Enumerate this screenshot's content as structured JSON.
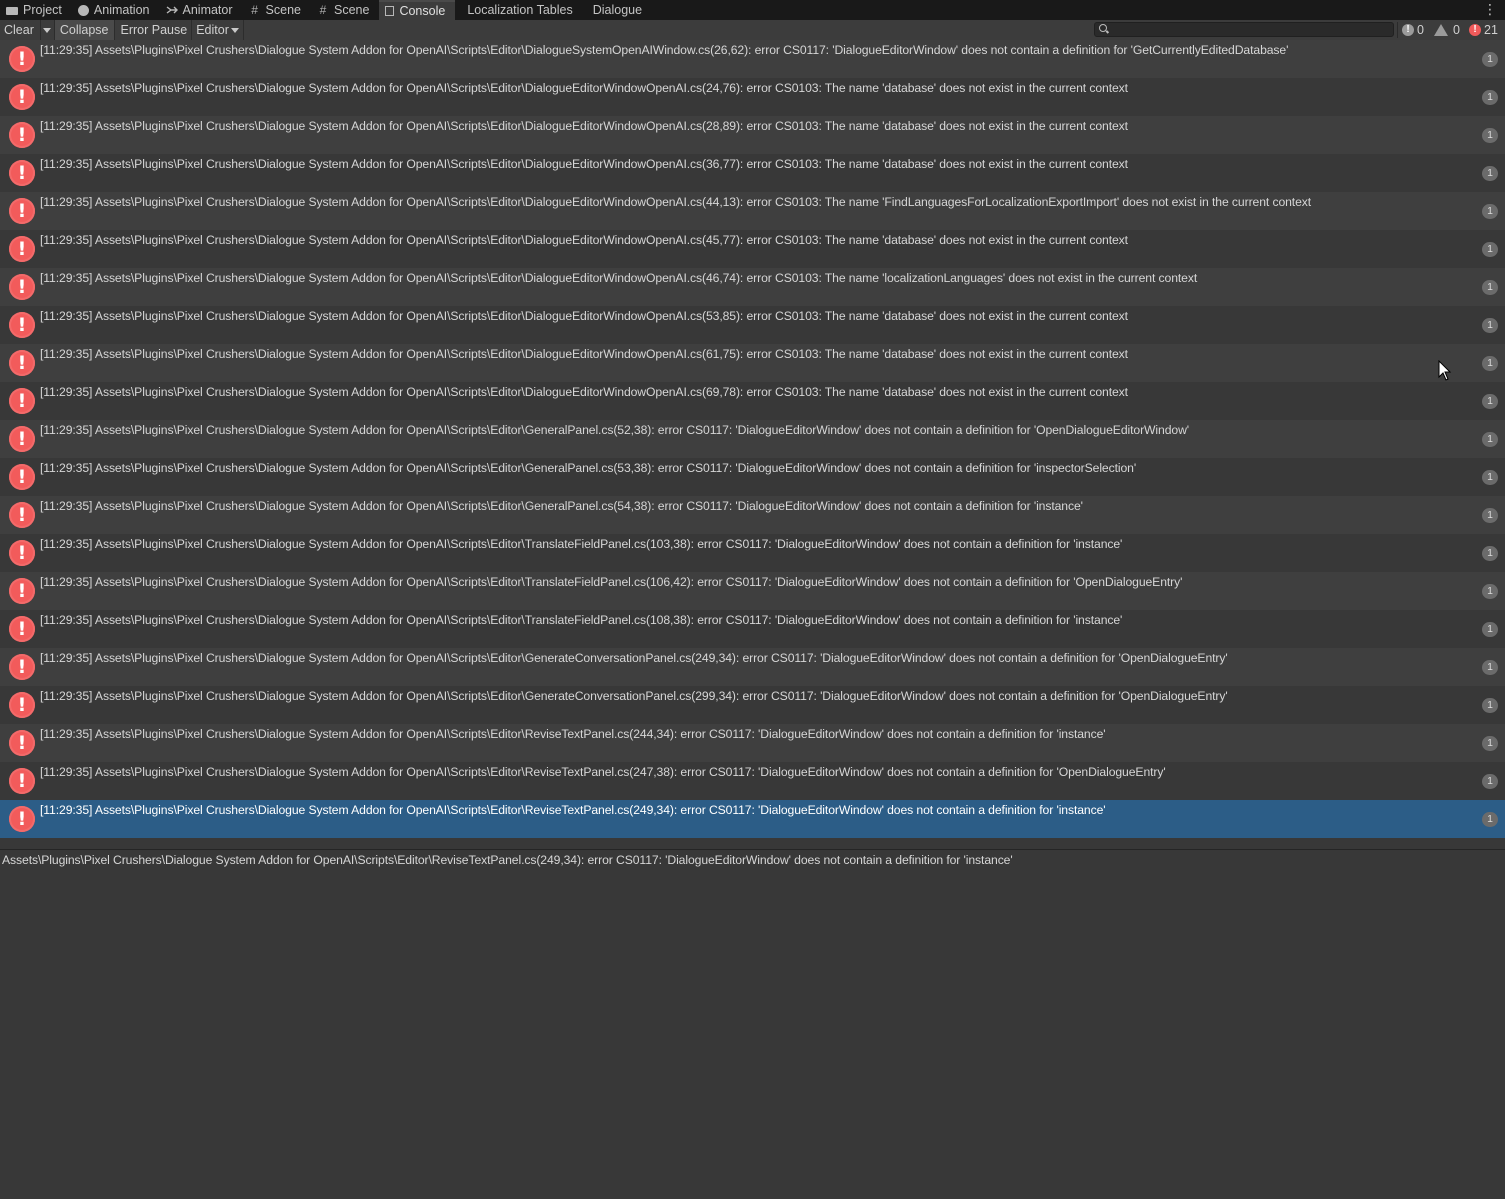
{
  "tabs": [
    {
      "label": "Project",
      "icon": "folder-icon"
    },
    {
      "label": "Animation",
      "icon": "animation-icon"
    },
    {
      "label": "Animator",
      "icon": "animator-icon"
    },
    {
      "label": "Scene",
      "icon": "scene-grid-icon"
    },
    {
      "label": "Scene",
      "icon": "scene-grid-icon"
    },
    {
      "label": "Console",
      "icon": "console-icon",
      "active": true
    },
    {
      "label": "Localization Tables"
    },
    {
      "label": "Dialogue"
    }
  ],
  "toolbar": {
    "clear": "Clear",
    "collapse": "Collapse",
    "error_pause": "Error Pause",
    "editor": "Editor",
    "search_placeholder": ""
  },
  "counts": {
    "info": "0",
    "warnings": "0",
    "errors": "21"
  },
  "colors": {
    "error": "#f25b5b",
    "selected": "#2c5d87",
    "panel": "#383838"
  },
  "log": [
    {
      "text": "[11:29:35] Assets\\Plugins\\Pixel Crushers\\Dialogue System Addon for OpenAI\\Scripts\\Editor\\DialogueSystemOpenAIWindow.cs(26,62): error CS0117: 'DialogueEditorWindow' does not contain a definition for 'GetCurrentlyEditedDatabase'",
      "count": "1"
    },
    {
      "text": "[11:29:35] Assets\\Plugins\\Pixel Crushers\\Dialogue System Addon for OpenAI\\Scripts\\Editor\\DialogueEditorWindowOpenAI.cs(24,76): error CS0103: The name 'database' does not exist in the current context",
      "count": "1"
    },
    {
      "text": "[11:29:35] Assets\\Plugins\\Pixel Crushers\\Dialogue System Addon for OpenAI\\Scripts\\Editor\\DialogueEditorWindowOpenAI.cs(28,89): error CS0103: The name 'database' does not exist in the current context",
      "count": "1"
    },
    {
      "text": "[11:29:35] Assets\\Plugins\\Pixel Crushers\\Dialogue System Addon for OpenAI\\Scripts\\Editor\\DialogueEditorWindowOpenAI.cs(36,77): error CS0103: The name 'database' does not exist in the current context",
      "count": "1"
    },
    {
      "text": "[11:29:35] Assets\\Plugins\\Pixel Crushers\\Dialogue System Addon for OpenAI\\Scripts\\Editor\\DialogueEditorWindowOpenAI.cs(44,13): error CS0103: The name 'FindLanguagesForLocalizationExportImport' does not exist in the current context",
      "count": "1"
    },
    {
      "text": "[11:29:35] Assets\\Plugins\\Pixel Crushers\\Dialogue System Addon for OpenAI\\Scripts\\Editor\\DialogueEditorWindowOpenAI.cs(45,77): error CS0103: The name 'database' does not exist in the current context",
      "count": "1"
    },
    {
      "text": "[11:29:35] Assets\\Plugins\\Pixel Crushers\\Dialogue System Addon for OpenAI\\Scripts\\Editor\\DialogueEditorWindowOpenAI.cs(46,74): error CS0103: The name 'localizationLanguages' does not exist in the current context",
      "count": "1"
    },
    {
      "text": "[11:29:35] Assets\\Plugins\\Pixel Crushers\\Dialogue System Addon for OpenAI\\Scripts\\Editor\\DialogueEditorWindowOpenAI.cs(53,85): error CS0103: The name 'database' does not exist in the current context",
      "count": "1"
    },
    {
      "text": "[11:29:35] Assets\\Plugins\\Pixel Crushers\\Dialogue System Addon for OpenAI\\Scripts\\Editor\\DialogueEditorWindowOpenAI.cs(61,75): error CS0103: The name 'database' does not exist in the current context",
      "count": "1"
    },
    {
      "text": "[11:29:35] Assets\\Plugins\\Pixel Crushers\\Dialogue System Addon for OpenAI\\Scripts\\Editor\\DialogueEditorWindowOpenAI.cs(69,78): error CS0103: The name 'database' does not exist in the current context",
      "count": "1"
    },
    {
      "text": "[11:29:35] Assets\\Plugins\\Pixel Crushers\\Dialogue System Addon for OpenAI\\Scripts\\Editor\\GeneralPanel.cs(52,38): error CS0117: 'DialogueEditorWindow' does not contain a definition for 'OpenDialogueEditorWindow'",
      "count": "1"
    },
    {
      "text": "[11:29:35] Assets\\Plugins\\Pixel Crushers\\Dialogue System Addon for OpenAI\\Scripts\\Editor\\GeneralPanel.cs(53,38): error CS0117: 'DialogueEditorWindow' does not contain a definition for 'inspectorSelection'",
      "count": "1"
    },
    {
      "text": "[11:29:35] Assets\\Plugins\\Pixel Crushers\\Dialogue System Addon for OpenAI\\Scripts\\Editor\\GeneralPanel.cs(54,38): error CS0117: 'DialogueEditorWindow' does not contain a definition for 'instance'",
      "count": "1"
    },
    {
      "text": "[11:29:35] Assets\\Plugins\\Pixel Crushers\\Dialogue System Addon for OpenAI\\Scripts\\Editor\\TranslateFieldPanel.cs(103,38): error CS0117: 'DialogueEditorWindow' does not contain a definition for 'instance'",
      "count": "1"
    },
    {
      "text": "[11:29:35] Assets\\Plugins\\Pixel Crushers\\Dialogue System Addon for OpenAI\\Scripts\\Editor\\TranslateFieldPanel.cs(106,42): error CS0117: 'DialogueEditorWindow' does not contain a definition for 'OpenDialogueEntry'",
      "count": "1"
    },
    {
      "text": "[11:29:35] Assets\\Plugins\\Pixel Crushers\\Dialogue System Addon for OpenAI\\Scripts\\Editor\\TranslateFieldPanel.cs(108,38): error CS0117: 'DialogueEditorWindow' does not contain a definition for 'instance'",
      "count": "1"
    },
    {
      "text": "[11:29:35] Assets\\Plugins\\Pixel Crushers\\Dialogue System Addon for OpenAI\\Scripts\\Editor\\GenerateConversationPanel.cs(249,34): error CS0117: 'DialogueEditorWindow' does not contain a definition for 'OpenDialogueEntry'",
      "count": "1"
    },
    {
      "text": "[11:29:35] Assets\\Plugins\\Pixel Crushers\\Dialogue System Addon for OpenAI\\Scripts\\Editor\\GenerateConversationPanel.cs(299,34): error CS0117: 'DialogueEditorWindow' does not contain a definition for 'OpenDialogueEntry'",
      "count": "1"
    },
    {
      "text": "[11:29:35] Assets\\Plugins\\Pixel Crushers\\Dialogue System Addon for OpenAI\\Scripts\\Editor\\ReviseTextPanel.cs(244,34): error CS0117: 'DialogueEditorWindow' does not contain a definition for 'instance'",
      "count": "1"
    },
    {
      "text": "[11:29:35] Assets\\Plugins\\Pixel Crushers\\Dialogue System Addon for OpenAI\\Scripts\\Editor\\ReviseTextPanel.cs(247,38): error CS0117: 'DialogueEditorWindow' does not contain a definition for 'OpenDialogueEntry'",
      "count": "1"
    },
    {
      "text": "[11:29:35] Assets\\Plugins\\Pixel Crushers\\Dialogue System Addon for OpenAI\\Scripts\\Editor\\ReviseTextPanel.cs(249,34): error CS0117: 'DialogueEditorWindow' does not contain a definition for 'instance'",
      "count": "1",
      "selected": true
    }
  ],
  "detail": "Assets\\Plugins\\Pixel Crushers\\Dialogue System Addon for OpenAI\\Scripts\\Editor\\ReviseTextPanel.cs(249,34): error CS0117: 'DialogueEditorWindow' does not contain a definition for 'instance'"
}
